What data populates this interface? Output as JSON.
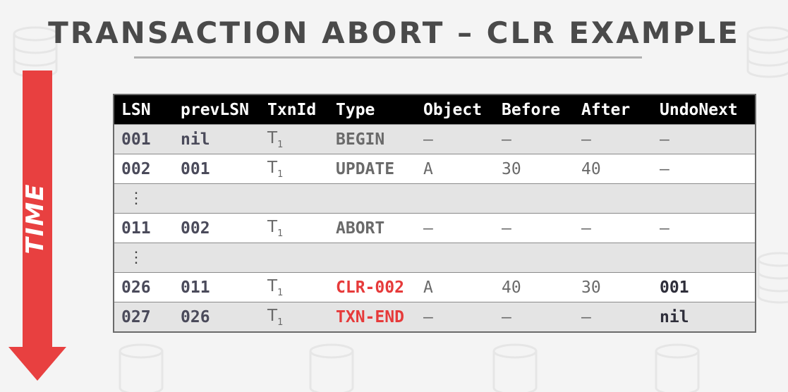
{
  "title": "TRANSACTION ABORT – CLR EXAMPLE",
  "time_label": "TIME",
  "colors": {
    "arrow": "#e84040",
    "header_bg": "#000000",
    "highlight": "#e63a3a",
    "title": "#4a4a4a"
  },
  "table": {
    "headers": [
      "LSN",
      "prevLSN",
      "TxnId",
      "Type",
      "Object",
      "Before",
      "After",
      "UndoNext"
    ],
    "rows": [
      {
        "lsn": "001",
        "prev": "nil",
        "txn": "T",
        "txn_sub": "1",
        "type": "BEGIN",
        "obj": "–",
        "before": "–",
        "after": "–",
        "undo": "–"
      },
      {
        "lsn": "002",
        "prev": "001",
        "txn": "T",
        "txn_sub": "1",
        "type": "UPDATE",
        "obj": "A",
        "before": "30",
        "after": "40",
        "undo": "–"
      },
      {
        "ellipsis": "⋮"
      },
      {
        "lsn": "011",
        "prev": "002",
        "txn": "T",
        "txn_sub": "1",
        "type": "ABORT",
        "obj": "–",
        "before": "–",
        "after": "–",
        "undo": "–"
      },
      {
        "ellipsis": "⋮"
      },
      {
        "lsn": "026",
        "prev": "011",
        "txn": "T",
        "txn_sub": "1",
        "type": "CLR-002",
        "obj": "A",
        "before": "40",
        "after": "30",
        "undo": "001"
      },
      {
        "lsn": "027",
        "prev": "026",
        "txn": "T",
        "txn_sub": "1",
        "type": "TXN-END",
        "obj": "–",
        "before": "–",
        "after": "–",
        "undo": "nil"
      }
    ]
  }
}
